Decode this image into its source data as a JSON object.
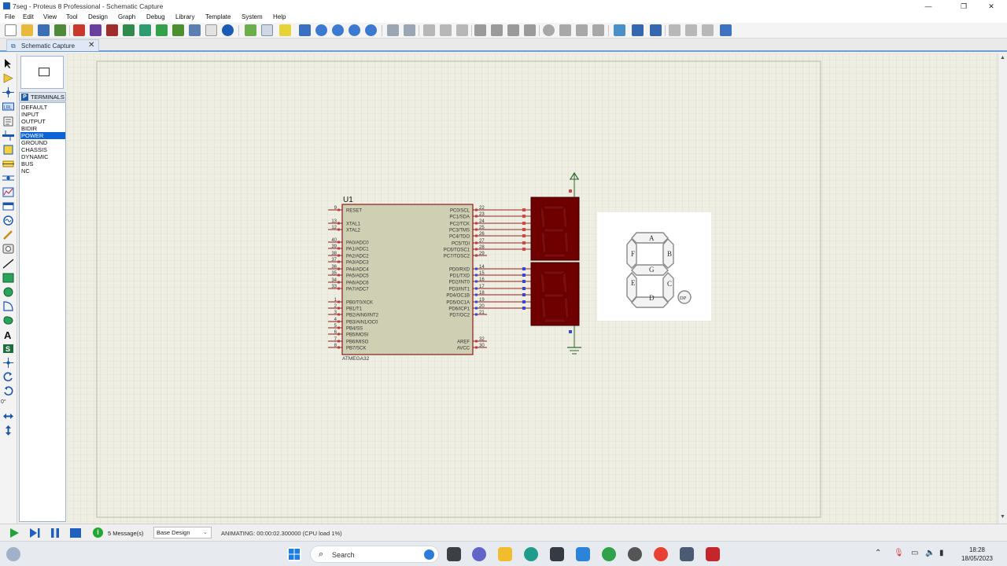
{
  "window": {
    "title": "7seg - Proteus 8 Professional - Schematic Capture",
    "controls": {
      "minimize": "—",
      "restore": "❐",
      "close": "✕"
    }
  },
  "menu": [
    "File",
    "Edit",
    "View",
    "Tool",
    "Design",
    "Graph",
    "Debug",
    "Library",
    "Template",
    "System",
    "Help"
  ],
  "tab": {
    "label": "Schematic Capture",
    "close": "✕"
  },
  "object_selector": {
    "mode_letter": "P",
    "header": "TERMINALS",
    "items": [
      "DEFAULT",
      "INPUT",
      "OUTPUT",
      "BIDIR",
      "POWER",
      "GROUND",
      "CHASSIS",
      "DYNAMIC",
      "BUS",
      "NC"
    ],
    "selected": "POWER"
  },
  "left_tools": {
    "rotation": "0°"
  },
  "schematic": {
    "mcu": {
      "ref": "U1",
      "part": "ATMEGA32",
      "left_pins": [
        {
          "num": "9",
          "name": "RESET"
        },
        {
          "num": "13",
          "name": "XTAL1"
        },
        {
          "num": "12",
          "name": "XTAL2"
        },
        {
          "num": "40",
          "name": "PA0/ADC0"
        },
        {
          "num": "39",
          "name": "PA1/ADC1"
        },
        {
          "num": "38",
          "name": "PA2/ADC2"
        },
        {
          "num": "37",
          "name": "PA3/ADC3"
        },
        {
          "num": "36",
          "name": "PA4/ADC4"
        },
        {
          "num": "35",
          "name": "PA5/ADC5"
        },
        {
          "num": "34",
          "name": "PA6/ADC6"
        },
        {
          "num": "33",
          "name": "PA7/ADC7"
        },
        {
          "num": "1",
          "name": "PB0/T0/XCK"
        },
        {
          "num": "2",
          "name": "PB1/T1"
        },
        {
          "num": "3",
          "name": "PB2/AIN0/INT2"
        },
        {
          "num": "4",
          "name": "PB3/AIN1/OC0"
        },
        {
          "num": "5",
          "name": "PB4/SS"
        },
        {
          "num": "6",
          "name": "PB5/MOSI"
        },
        {
          "num": "7",
          "name": "PB6/MISO"
        },
        {
          "num": "8",
          "name": "PB7/SCK"
        }
      ],
      "right_pins": [
        {
          "num": "22",
          "name": "PC0/SCL"
        },
        {
          "num": "23",
          "name": "PC1/SDA"
        },
        {
          "num": "24",
          "name": "PC2/TCK"
        },
        {
          "num": "25",
          "name": "PC3/TMS"
        },
        {
          "num": "26",
          "name": "PC4/TDO"
        },
        {
          "num": "27",
          "name": "PC5/TDI"
        },
        {
          "num": "28",
          "name": "PC6/TOSC1"
        },
        {
          "num": "29",
          "name": "PC7/TOSC2"
        },
        {
          "num": "14",
          "name": "PD0/RXD"
        },
        {
          "num": "15",
          "name": "PD1/TXD"
        },
        {
          "num": "16",
          "name": "PD2/INT0"
        },
        {
          "num": "17",
          "name": "PD3/INT1"
        },
        {
          "num": "18",
          "name": "PD4/OC1B"
        },
        {
          "num": "19",
          "name": "PD5/OC1A"
        },
        {
          "num": "20",
          "name": "PD6/ICP1"
        },
        {
          "num": "21",
          "name": "PD7/OC2"
        },
        {
          "num": "32",
          "name": "AREF"
        },
        {
          "num": "30",
          "name": "AVCC"
        }
      ]
    },
    "segment_diagram": {
      "labels": [
        "A",
        "B",
        "C",
        "D",
        "E",
        "F",
        "G",
        "DP"
      ]
    }
  },
  "status": {
    "messages": "5 Message(s)",
    "design": "Base Design",
    "animation": "ANIMATING: 00:00:02.300000 (CPU load 1%)"
  },
  "taskbar": {
    "search": "Search",
    "time": "18:28",
    "date": "18/05/2023"
  },
  "colors": {
    "sheet": "#eeeee2",
    "grid": "#d4d4c2",
    "chip_body": "#cfcfb4",
    "wire": "#9b2323",
    "display": "#6e0000",
    "selected": "#0a64d8"
  }
}
